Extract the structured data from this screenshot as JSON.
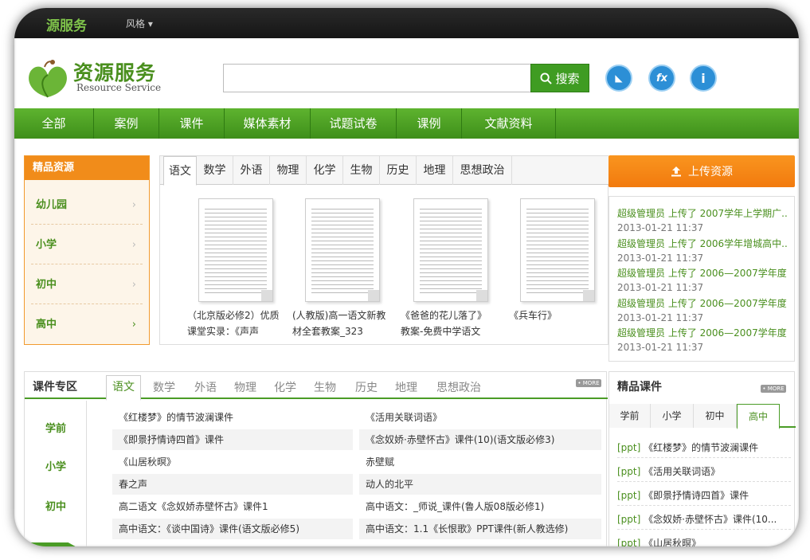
{
  "topbar": {
    "brand": "源服务",
    "style_label": "风格 ▾"
  },
  "logo": {
    "cn": "资源服务",
    "en": "Resource Service"
  },
  "search": {
    "placeholder": "",
    "button_label": "搜索"
  },
  "tools": [
    {
      "label": "◣"
    },
    {
      "label": "fx"
    },
    {
      "label": "i"
    }
  ],
  "nav": [
    "全部",
    "案例",
    "课件",
    "媒体素材",
    "试题试卷",
    "课例",
    "文献资料"
  ],
  "featured": {
    "title": "精品资源",
    "levels": [
      "幼儿园",
      "小学",
      "初中",
      "高中"
    ],
    "chevron": "›"
  },
  "subject_tabs": [
    "语文",
    "数学",
    "外语",
    "物理",
    "化学",
    "生物",
    "历史",
    "地理",
    "思想政治"
  ],
  "documents": [
    {
      "caption": "（北京版必修2）优质课堂实录：《声声"
    },
    {
      "caption": "(人教版)高一语文新教材全套教案_323"
    },
    {
      "caption": "《爸爸的花儿落了》教案-免费中学语文"
    },
    {
      "caption": "《兵车行》"
    }
  ],
  "upload": {
    "label": "上传资源",
    "icon": "upload-icon"
  },
  "activity": [
    {
      "text": "超级管理员 上传了 2007学年上学期广...",
      "time": "2013-01-21 11:37"
    },
    {
      "text": "超级管理员 上传了 2006学年增城高中...",
      "time": "2013-01-21 11:37"
    },
    {
      "text": "超级管理员 上传了 2006—2007学年度...",
      "time": "2013-01-21 11:37"
    },
    {
      "text": "超级管理员 上传了 2006—2007学年度...",
      "time": "2013-01-21 11:37"
    },
    {
      "text": "超级管理员 上传了 2006—2007学年度...",
      "time": "2013-01-21 11:37"
    }
  ],
  "courseware": {
    "title": "课件专区",
    "more": "• MORE",
    "tabs": [
      "语文",
      "数学",
      "外语",
      "物理",
      "化学",
      "生物",
      "历史",
      "地理",
      "思想政治"
    ],
    "levels": [
      "学前",
      "小学",
      "初中"
    ],
    "rows_left": [
      "《红楼梦》的情节波澜课件",
      "《即景抒情诗四首》课件",
      "《山居秋暝》",
      "春之声",
      "高二语文《念奴娇赤壁怀古》课件1",
      "高中语文：《谈中国诗》课件(语文版必修5)"
    ],
    "rows_right": [
      "《活用关联词语》",
      "《念奴娇·赤壁怀古》课件(10)(语文版必修3)",
      "赤壁赋",
      "动人的北平",
      "高中语文：_师说_课件(鲁人版08版必修1)",
      "高中语文：1.1《长恨歌》PPT课件(新人教选修)"
    ]
  },
  "premium": {
    "title": "精品课件",
    "more": "• MORE",
    "tabs": [
      "学前",
      "小学",
      "初中",
      "高中"
    ],
    "items": [
      {
        "tag": "[ppt]",
        "text": "《红楼梦》的情节波澜课件"
      },
      {
        "tag": "[ppt]",
        "text": "《活用关联词语》"
      },
      {
        "tag": "[ppt]",
        "text": "《即景抒情诗四首》课件"
      },
      {
        "tag": "[ppt]",
        "text": "《念奴娇·赤壁怀古》课件(10..."
      },
      {
        "tag": "[ppt]",
        "text": "《山居秋暝》"
      }
    ]
  }
}
